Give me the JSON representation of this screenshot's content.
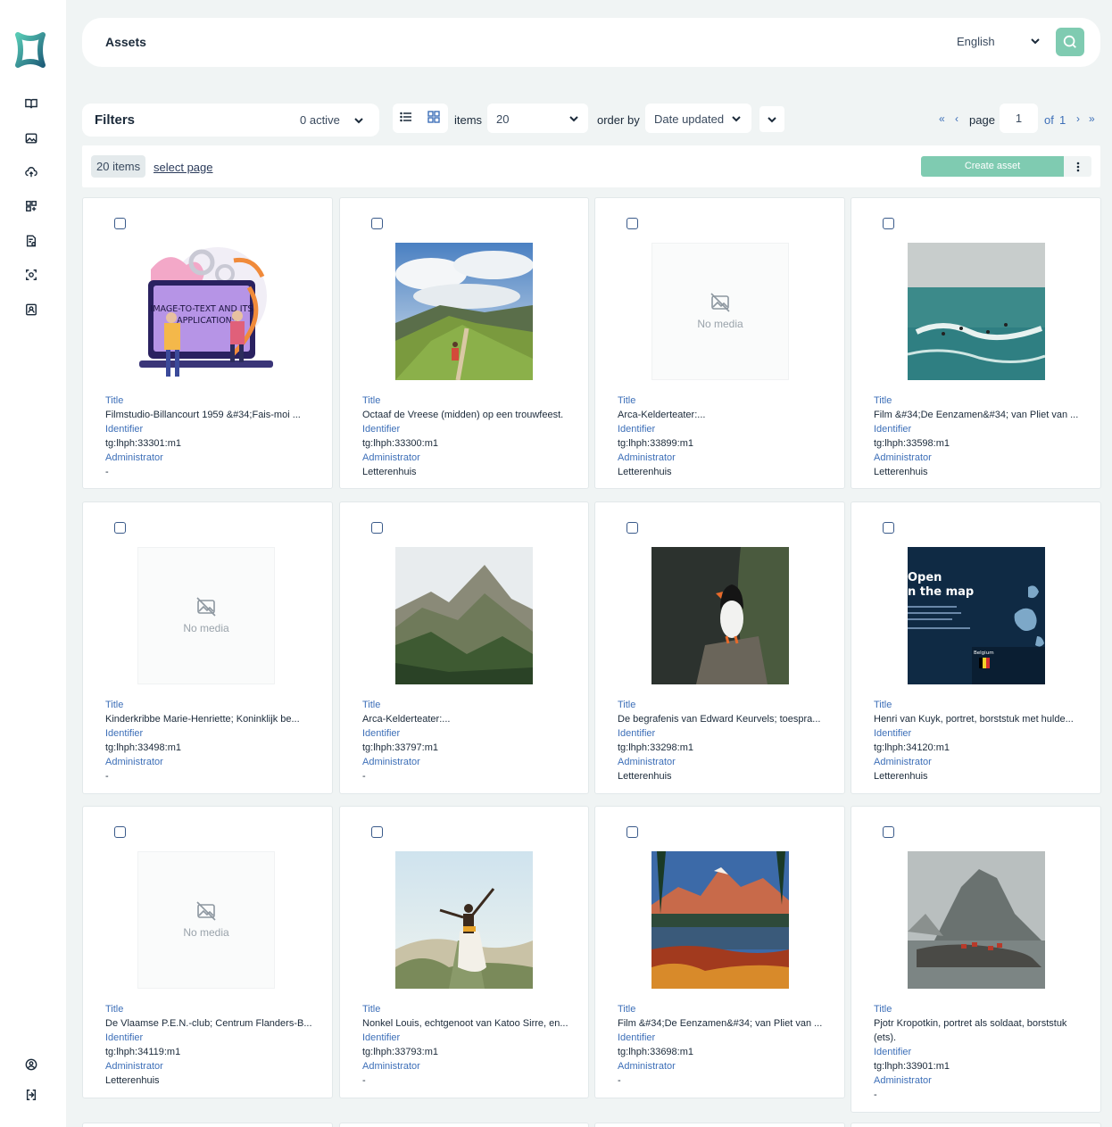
{
  "header": {
    "title": "Assets",
    "language": "English"
  },
  "filters": {
    "title": "Filters",
    "active": "0 active"
  },
  "toolbar": {
    "items_label": "items",
    "items_value": "20",
    "order_label": "order by",
    "order_value": "Date updated",
    "page_label": "page",
    "page_value": "1",
    "of_label": "of",
    "total_pages": "1",
    "first_icon": "«",
    "prev_icon": "‹",
    "next_icon": "›",
    "last_icon": "»"
  },
  "actionbar": {
    "count": "20 items",
    "select_page": "select page",
    "create": "Create asset"
  },
  "labels": {
    "title": "Title",
    "identifier": "Identifier",
    "administrator": "Administrator",
    "no_media": "No media"
  },
  "cards": [
    {
      "title": "Filmstudio-Billancourt 1959 &#34;Fais-moi ...",
      "identifier": "tg:lhph:33301:m1",
      "administrator": "-",
      "media": "illustration",
      "illustration_text": "IMAGE-TO-TEXT AND ITS APPLICATIONS"
    },
    {
      "title": "Octaaf de Vreese (midden) op een trouwfeest.",
      "identifier": "tg:lhph:33300:m1",
      "administrator": "Letterenhuis",
      "media": "path"
    },
    {
      "title": "Arca-Kelderteater:...",
      "identifier": "tg:lhph:33899:m1",
      "administrator": "Letterenhuis",
      "media": "none"
    },
    {
      "title": "Film &#34;De Eenzamen&#34; van Pliet van ...",
      "identifier": "tg:lhph:33598:m1",
      "administrator": "Letterenhuis",
      "media": "surf"
    },
    {
      "title": "Kinderkribbe Marie-Henriette; Koninklijk be...",
      "identifier": "tg:lhph:33498:m1",
      "administrator": "-",
      "media": "none"
    },
    {
      "title": "Arca-Kelderteater:...",
      "identifier": "tg:lhph:33797:m1",
      "administrator": "-",
      "media": "mountain"
    },
    {
      "title": "De begrafenis van Edward Keurvels; toespra...",
      "identifier": "tg:lhph:33298:m1",
      "administrator": "Letterenhuis",
      "media": "puffin"
    },
    {
      "title": "Henri van Kuyk, portret, borststuk met hulde...",
      "identifier": "tg:lhph:34120:m1",
      "administrator": "Letterenhuis",
      "media": "map",
      "map_heading_1": "Open",
      "map_heading_2": "n the map",
      "map_country": "Belgium"
    },
    {
      "title": "De Vlaamse P.E.N.-club; Centrum Flanders-B...",
      "identifier": "tg:lhph:34119:m1",
      "administrator": "Letterenhuis",
      "media": "none"
    },
    {
      "title": "Nonkel Louis, echtgenoot van Katoo Sirre, en...",
      "identifier": "tg:lhph:33793:m1",
      "administrator": "-",
      "media": "dancer"
    },
    {
      "title": "Film &#34;De Eenzamen&#34; van Pliet van ...",
      "identifier": "tg:lhph:33698:m1",
      "administrator": "-",
      "media": "lake"
    },
    {
      "title": "Pjotr Kropotkin, portret als soldaat, borststuk (ets).",
      "identifier": "tg:lhph:33901:m1",
      "administrator": "-",
      "media": "fjord",
      "wrap": true
    }
  ],
  "colors": {
    "accent": "#7fcbb1",
    "link": "#3d6fb8",
    "background": "#f0f4f4"
  }
}
